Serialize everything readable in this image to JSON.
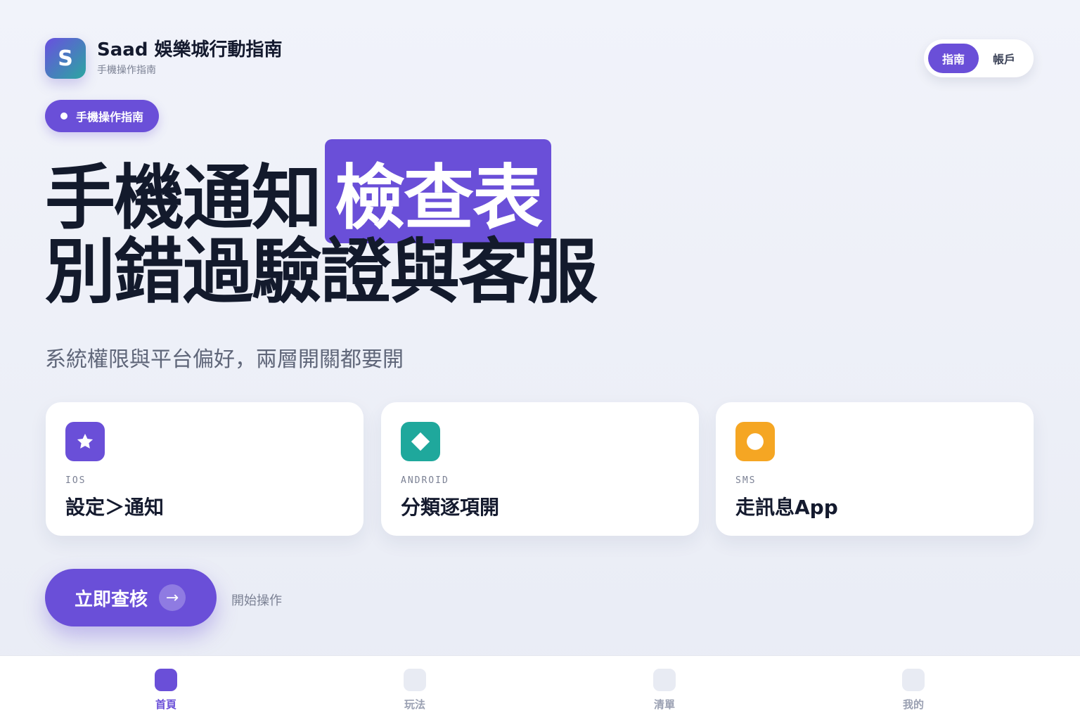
{
  "header": {
    "logo_letter": "S",
    "title": "Saad 娛樂城行動指南",
    "subtitle": "手機操作指南",
    "segment": {
      "active": "指南",
      "other": "帳戶"
    }
  },
  "pill": "手機操作指南",
  "headline": {
    "line1_plain": "手機通知",
    "line1_highlight": "檢查表",
    "line2": "別錯過驗證與客服"
  },
  "subtitle": "系統權限與平台偏好，兩層開關都要開",
  "cards": [
    {
      "tag": "IOS",
      "label": "設定＞通知",
      "icon": "star-icon",
      "color": "#6a4fd8"
    },
    {
      "tag": "ANDROID",
      "label": "分類逐項開",
      "icon": "diamond-icon",
      "color": "#1fa89c"
    },
    {
      "tag": "SMS",
      "label": "走訊息App",
      "icon": "circle-icon",
      "color": "#f5a623"
    }
  ],
  "cta": {
    "label": "立即查核",
    "arrow": "→",
    "hint": "開始操作"
  },
  "nav": [
    {
      "label": "首頁",
      "active": true
    },
    {
      "label": "玩法",
      "active": false
    },
    {
      "label": "清單",
      "active": false
    },
    {
      "label": "我的",
      "active": false
    }
  ],
  "colors": {
    "accent": "#6a4fd8",
    "text": "#141a2e",
    "muted": "#7b8194"
  }
}
